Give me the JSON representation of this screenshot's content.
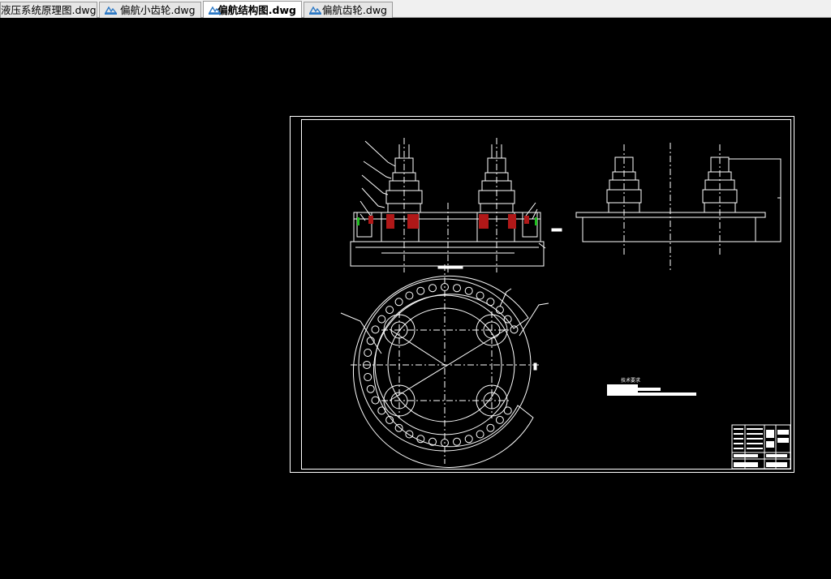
{
  "tabs": [
    {
      "label": "液压系统原理图.dwg",
      "active": false,
      "icon": "dwg-file-icon"
    },
    {
      "label": "偏航小齿轮.dwg",
      "active": false,
      "icon": "dwg-file-icon"
    },
    {
      "label": "偏航结构图.dwg",
      "active": true,
      "icon": "dwg-file-icon"
    },
    {
      "label": "偏航齿轮.dwg",
      "active": false,
      "icon": "dwg-file-icon"
    }
  ],
  "drawing": {
    "tech_notes_title": "技术要求",
    "colors": {
      "background": "#000000",
      "lines": "#ffffff",
      "section_fill": "#b01818",
      "green_mark": "#20c020"
    }
  }
}
